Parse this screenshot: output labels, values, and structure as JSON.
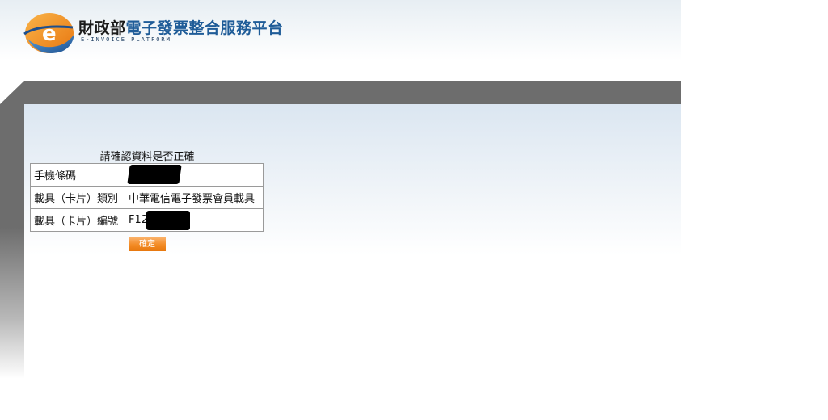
{
  "header": {
    "title_part1": "財政部",
    "title_part2": "電子發票整合服務平台",
    "subtitle": "E-INVOICE PLATFORM"
  },
  "form": {
    "title": "請確認資料是否正確",
    "rows": [
      {
        "label": "手機條碼",
        "value": ""
      },
      {
        "label": "載具（卡片）類別",
        "value": "中華電信電子發票會員載具"
      },
      {
        "label": "載具（卡片）編號",
        "value": "F12"
      }
    ],
    "confirm_label": "確定"
  },
  "colors": {
    "frame": "#6d6d6d",
    "brand_blue": "#1f5c98",
    "button_orange": "#f28a24"
  },
  "icons": {
    "logo": "e-invoice-logo-icon"
  }
}
